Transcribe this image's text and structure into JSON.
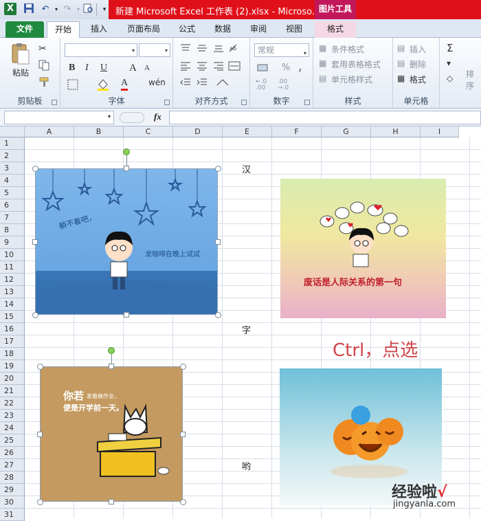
{
  "title_bar": {
    "title": "新建 Microsoft Excel 工作表 (2).xlsx - Microso...",
    "context_tab": "图片工具"
  },
  "tabs": [
    {
      "label": "文件"
    },
    {
      "label": "开始"
    },
    {
      "label": "插入"
    },
    {
      "label": "页面布局"
    },
    {
      "label": "公式"
    },
    {
      "label": "数据"
    },
    {
      "label": "审阅"
    },
    {
      "label": "视图"
    },
    {
      "label": "格式"
    }
  ],
  "ribbon": {
    "clipboard": {
      "label": "剪贴板",
      "paste": "粘贴"
    },
    "font": {
      "label": "字体",
      "bold": "B",
      "italic": "I",
      "underline": "U",
      "grow": "A",
      "shrink": "A",
      "wen": "wén",
      "font_color": "A"
    },
    "alignment": {
      "label": "对齐方式"
    },
    "number": {
      "label": "数字",
      "format": "常规",
      "percent": "%",
      "comma": ","
    },
    "styles": {
      "label": "样式",
      "conditional": "条件格式",
      "table_format": "套用表格格式",
      "cell_styles": "单元格样式"
    },
    "cells": {
      "label": "单元格",
      "insert": "插入",
      "delete": "删除",
      "format": "格式"
    },
    "editing": {
      "sum": "Σ",
      "sort": "排序"
    }
  },
  "formula_bar": {
    "fx": "fx",
    "name_box": "",
    "formula": ""
  },
  "columns": [
    "A",
    "B",
    "C",
    "D",
    "E",
    "F",
    "G",
    "H",
    "I"
  ],
  "rows": [
    "1",
    "2",
    "3",
    "4",
    "5",
    "6",
    "7",
    "8",
    "9",
    "10",
    "11",
    "12",
    "13",
    "14",
    "15",
    "16",
    "17",
    "18",
    "19",
    "20",
    "21",
    "22",
    "23",
    "24",
    "25",
    "26",
    "27",
    "28",
    "29",
    "30",
    "31"
  ],
  "cells": {
    "e3": "汉",
    "e16": "字",
    "e27": "哟"
  },
  "images": {
    "pic1": {
      "text1": "躺不着吧，",
      "text2": "龙咖啡在晚上试试"
    },
    "pic2": {
      "caption": "废话是人际关系的第一句"
    },
    "pic3": {
      "line1": "你若",
      "line1_small": "发着做作业，",
      "line2": "便是开学前一天。"
    },
    "pic4": {}
  },
  "annotation": "Ctrl，点选",
  "watermark": {
    "main": "经验啦",
    "check": "√",
    "url": "jingyanla.com"
  }
}
